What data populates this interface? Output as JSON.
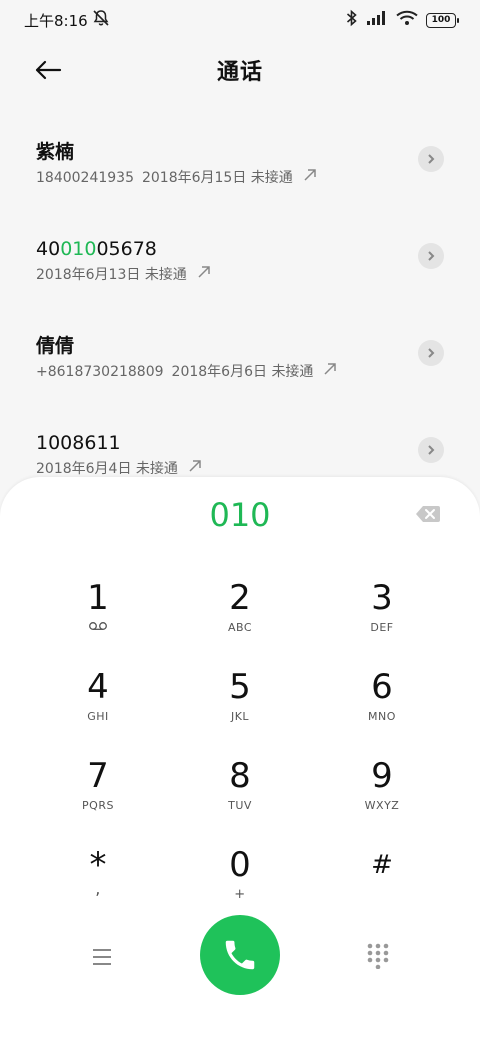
{
  "status_bar": {
    "time": "上午8:16",
    "battery": "100"
  },
  "header": {
    "title": "通话"
  },
  "calls": [
    {
      "name": "紫楠",
      "number": "18400241935",
      "date": "2018年6月15日",
      "status": "未接通"
    },
    {
      "name_prefix": "40",
      "name_match": "010",
      "name_suffix": "05678",
      "date": "2018年6月13日",
      "status": "未接通"
    },
    {
      "name": "倩倩",
      "number": "+8618730218809",
      "date": "2018年6月6日",
      "status": "未接通"
    },
    {
      "name": "1008611",
      "date": "2018年6月4日",
      "status": "未接通"
    }
  ],
  "dialpad": {
    "input": "010",
    "keys": [
      {
        "digit": "1",
        "sub": "voicemail-icon"
      },
      {
        "digit": "2",
        "sub": "ABC"
      },
      {
        "digit": "3",
        "sub": "DEF"
      },
      {
        "digit": "4",
        "sub": "GHI"
      },
      {
        "digit": "5",
        "sub": "JKL"
      },
      {
        "digit": "6",
        "sub": "MNO"
      },
      {
        "digit": "7",
        "sub": "PQRS"
      },
      {
        "digit": "8",
        "sub": "TUV"
      },
      {
        "digit": "9",
        "sub": "WXYZ"
      },
      {
        "digit": "*",
        "sub": ","
      },
      {
        "digit": "0",
        "sub": "+"
      },
      {
        "digit": "#",
        "sub": ""
      }
    ]
  },
  "colors": {
    "accent": "#1fb855",
    "call_button": "#1fc25a"
  }
}
